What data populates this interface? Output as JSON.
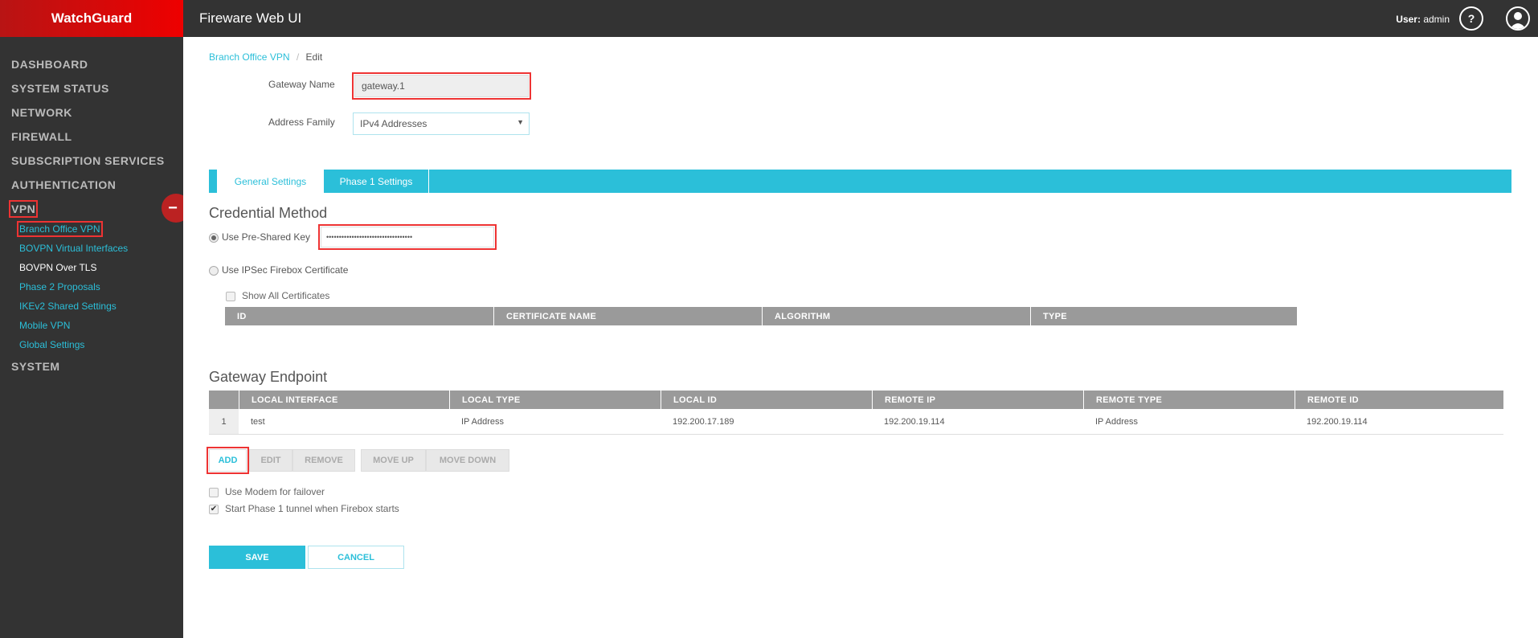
{
  "brand": "WatchGuard",
  "header": {
    "title": "Fireware Web UI",
    "user_label": "User:",
    "user_name": "admin",
    "help": "?"
  },
  "sidebar": {
    "items": [
      "DASHBOARD",
      "SYSTEM STATUS",
      "NETWORK",
      "FIREWALL",
      "SUBSCRIPTION SERVICES",
      "AUTHENTICATION",
      "VPN",
      "SYSTEM"
    ],
    "vpn_sub": [
      "Branch Office VPN",
      "BOVPN Virtual Interfaces",
      "BOVPN Over TLS",
      "Phase 2 Proposals",
      "IKEv2 Shared Settings",
      "Mobile VPN",
      "Global Settings"
    ],
    "collapse": "−"
  },
  "breadcrumb": {
    "parent": "Branch Office VPN",
    "sep": "/",
    "current": "Edit"
  },
  "form": {
    "gateway_name_label": "Gateway Name",
    "gateway_name": "gateway.1",
    "address_family_label": "Address Family",
    "address_family": "IPv4 Addresses"
  },
  "tabs": [
    "General Settings",
    "Phase 1 Settings"
  ],
  "credential": {
    "title": "Credential Method",
    "psk_label": "Use Pre-Shared Key",
    "psk_value": "••••••••••••••••••••••••••••••••••",
    "cert_label": "Use IPSec Firebox Certificate",
    "show_all": "Show All Certificates",
    "columns": [
      "ID",
      "CERTIFICATE NAME",
      "ALGORITHM",
      "TYPE"
    ]
  },
  "endpoint": {
    "title": "Gateway Endpoint",
    "columns": [
      "LOCAL INTERFACE",
      "LOCAL TYPE",
      "LOCAL ID",
      "REMOTE IP",
      "REMOTE TYPE",
      "REMOTE ID"
    ],
    "rows": [
      {
        "index": "1",
        "cells": [
          "test",
          "IP Address",
          "192.200.17.189",
          "192.200.19.114",
          "IP Address",
          "192.200.19.114"
        ]
      }
    ]
  },
  "buttons": {
    "add": "ADD",
    "edit": "EDIT",
    "remove": "REMOVE",
    "move_up": "MOVE UP",
    "move_down": "MOVE DOWN",
    "save": "SAVE",
    "cancel": "CANCEL"
  },
  "options": {
    "modem": "Use Modem for failover",
    "modem_checked": false,
    "start_phase1": "Start Phase 1 tunnel when Firebox starts",
    "start_phase1_checked": true
  },
  "colors": {
    "accent": "#2bbfd9",
    "brand": "#d40000",
    "header": "#333333"
  }
}
